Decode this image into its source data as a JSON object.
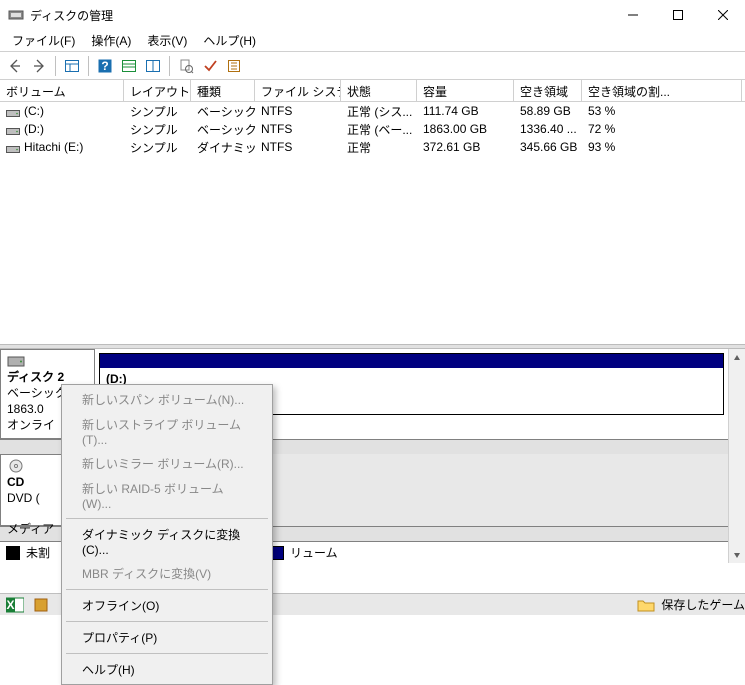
{
  "window": {
    "title": "ディスクの管理"
  },
  "menubar": {
    "file": "ファイル(F)",
    "action": "操作(A)",
    "view": "表示(V)",
    "help": "ヘルプ(H)"
  },
  "columns": {
    "volume": "ボリューム",
    "layout": "レイアウト",
    "type": "種類",
    "fs": "ファイル システム",
    "status": "状態",
    "capacity": "容量",
    "free": "空き領域",
    "pct": "空き領域の割..."
  },
  "volumes": [
    {
      "name": "(C:)",
      "layout": "シンプル",
      "type": "ベーシック",
      "fs": "NTFS",
      "status": "正常 (シス...",
      "capacity": "111.74 GB",
      "free": "58.89 GB",
      "pct": "53 %"
    },
    {
      "name": "(D:)",
      "layout": "シンプル",
      "type": "ベーシック",
      "fs": "NTFS",
      "status": "正常 (ベー...",
      "capacity": "1863.00 GB",
      "free": "1336.40 ...",
      "pct": "72 %"
    },
    {
      "name": "Hitachi (E:)",
      "layout": "シンプル",
      "type": "ダイナミック",
      "fs": "NTFS",
      "status": "正常",
      "capacity": "372.61 GB",
      "free": "345.66 GB",
      "pct": "93 %"
    }
  ],
  "diskpane": {
    "disk2": {
      "title": "ディスク 2",
      "type": "ベーシック",
      "size": "1863.0",
      "state": "オンライ",
      "part_name": "(D:)"
    },
    "cd": {
      "title": "CD",
      "sub1": "DVD (",
      "sub2": "メディア"
    },
    "legend1": "未割",
    "legend2": "リューム"
  },
  "context_menu": {
    "i0": "新しいスパン ボリューム(N)...",
    "i1": "新しいストライプ ボリューム(T)...",
    "i2": "新しいミラー ボリューム(R)...",
    "i3": "新しい RAID-5 ボリューム(W)...",
    "i4": "ダイナミック ディスクに変換(C)...",
    "i5": "MBR ディスクに変換(V)",
    "i6": "オフライン(O)",
    "i7": "プロパティ(P)",
    "i8": "ヘルプ(H)"
  },
  "taskbar": {
    "label": "保存したゲーム"
  }
}
